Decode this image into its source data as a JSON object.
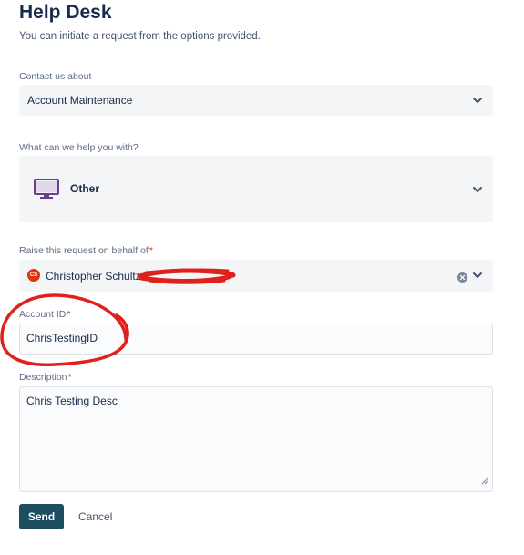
{
  "page": {
    "title": "Help Desk",
    "subtitle": "You can initiate a request from the options provided."
  },
  "contact": {
    "label": "Contact us about",
    "value": "Account Maintenance"
  },
  "help_with": {
    "label": "What can we help you with?",
    "value": "Other"
  },
  "on_behalf": {
    "label": "Raise this request on behalf of",
    "required_mark": "*",
    "avatar_initials": "CS",
    "value": "Christopher Schultz"
  },
  "account_id": {
    "label": "Account ID",
    "required_mark": "*",
    "value": "ChrisTestingID"
  },
  "description": {
    "label": "Description",
    "required_mark": "*",
    "value": "Chris Testing Desc"
  },
  "actions": {
    "send": "Send",
    "cancel": "Cancel"
  },
  "colors": {
    "primary_button": "#1d4d5e",
    "required_asterisk": "#de350b",
    "avatar": "#de350b",
    "annotation": "#e0201c",
    "monitor_icon": "#6b3d8f"
  },
  "icons": {
    "chevron": "chevron-down-icon",
    "monitor": "monitor-icon",
    "clear": "clear-icon",
    "resize": "resize-handle-icon"
  }
}
